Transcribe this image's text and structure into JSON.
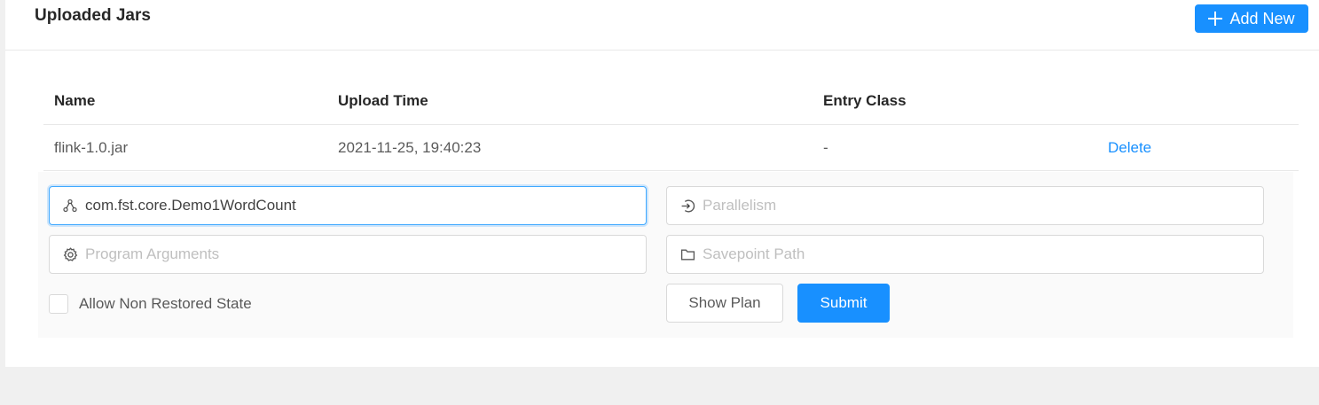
{
  "card": {
    "title": "Uploaded Jars",
    "add_button_label": "Add New"
  },
  "table": {
    "columns": [
      "Name",
      "Upload Time",
      "Entry Class"
    ],
    "rows": [
      {
        "name": "flink-1.0.jar",
        "upload_time": "2021-11-25, 19:40:23",
        "entry_class": "-",
        "action": "Delete"
      }
    ]
  },
  "form": {
    "entry_class": {
      "value": "com.fst.core.Demo1WordCount",
      "icon": "cluster-icon"
    },
    "parallelism": {
      "placeholder": "Parallelism",
      "icon": "login-icon"
    },
    "program_arguments": {
      "placeholder": "Program Arguments",
      "icon": "setting-icon"
    },
    "savepoint_path": {
      "placeholder": "Savepoint Path",
      "icon": "folder-icon"
    },
    "allow_non_restored_label": "Allow Non Restored State",
    "show_plan_label": "Show Plan",
    "submit_label": "Submit"
  },
  "colors": {
    "primary": "#1890ff",
    "background": "#f0f0f0",
    "expanded_row_bg": "#fafafa"
  }
}
